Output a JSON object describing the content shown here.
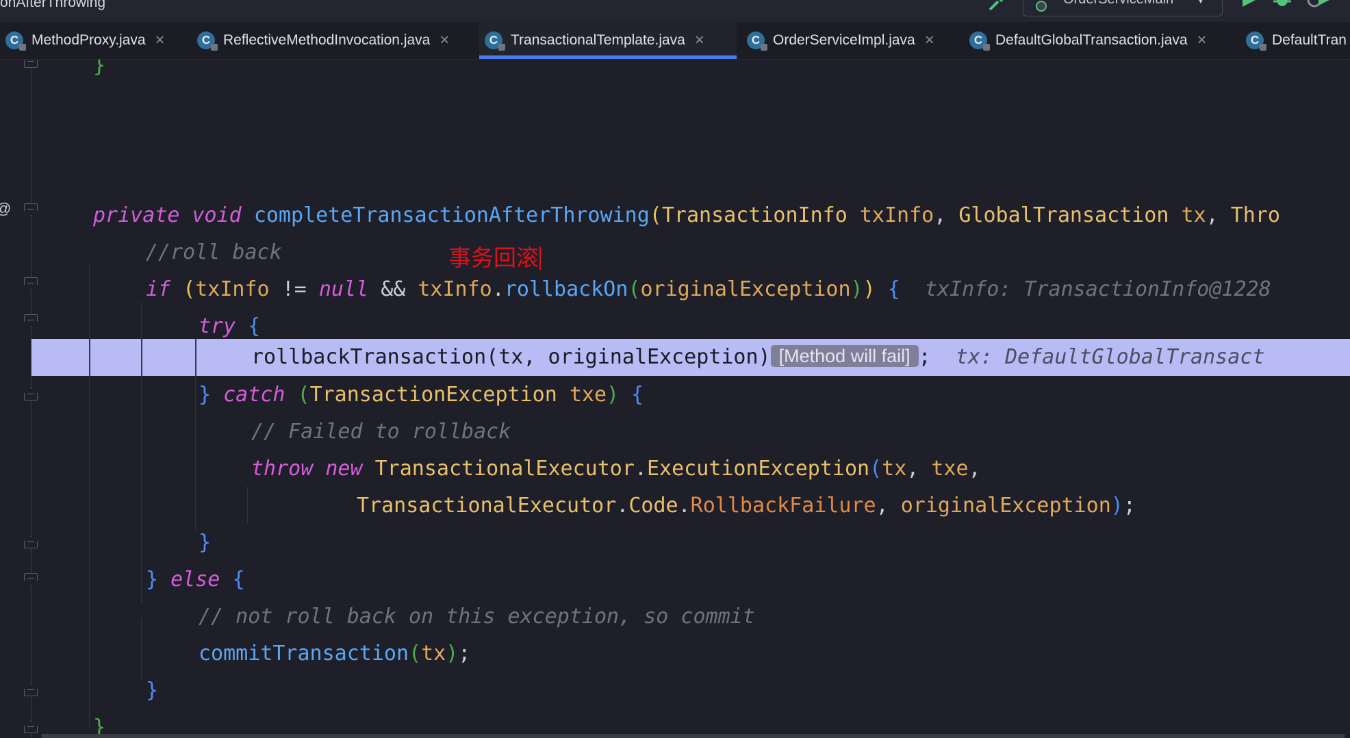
{
  "header": {
    "breadcrumb": "onAfterThrowing",
    "run_config": "OrderServiceMain"
  },
  "icons": {
    "hammer": "hammer-icon",
    "run": "play-icon",
    "debug": "bug-icon",
    "coverage": "coverage-icon",
    "chevron": "chevron-down-icon"
  },
  "colors": {
    "accent": "#4a7bf0",
    "keyword": "#d45dd9",
    "function": "#5aa7f5",
    "type": "#e8c06a",
    "comment": "#6e7281",
    "highlight": "#b9bbf5",
    "annotation_red": "#e0101a"
  },
  "tabs": [
    {
      "label": "MethodProxy.java",
      "close": "×"
    },
    {
      "label": "ReflectiveMethodInvocation.java",
      "close": "×"
    },
    {
      "label": "TransactionalTemplate.java",
      "close": "×"
    },
    {
      "label": "OrderServiceImpl.java",
      "close": "×"
    },
    {
      "label": "DefaultGlobalTransaction.java",
      "close": "×"
    },
    {
      "label": "DefaultTran",
      "close": ""
    }
  ],
  "tab_icon_letter": "C",
  "gutter": {
    "annotation": "@"
  },
  "code": {
    "l0": {
      "brace": "}"
    },
    "l1": {
      "kw1": "private",
      "kw2": "void",
      "fn": "completeTransactionAfterThrowing",
      "open": "(",
      "t1": "TransactionInfo",
      "p1": "txInfo",
      "comma1": ",",
      "t2": "GlobalTransaction",
      "p2": "tx",
      "comma2": ",",
      "t3": "Thro"
    },
    "l2": {
      "comment": "//roll back"
    },
    "l3": {
      "kw": "if",
      "open": "(",
      "v1": "txInfo",
      "op1": "!=",
      "kw2": "null",
      "op2": "&&",
      "v2": "txInfo",
      "dot": ".",
      "fn": "rollbackOn",
      "open2": "(",
      "arg": "originalException",
      "close2": ")",
      "close": ")",
      "brace": "{",
      "hint": "txInfo: TransactionInfo@1228"
    },
    "l4": {
      "kw": "try",
      "brace": "{"
    },
    "l5": {
      "call": "rollbackTransaction(tx, originalException)",
      "badge": "[Method will fail]",
      "semi": ";",
      "hint": "tx: DefaultGlobalTransact"
    },
    "l6": {
      "rb": "}",
      "kw": "catch",
      "open": "(",
      "t": "TransactionException",
      "p": "txe",
      "close": ")",
      "brace": "{"
    },
    "l7": {
      "comment": "// Failed to rollback"
    },
    "l8": {
      "kw1": "throw",
      "kw2": "new",
      "t1": "TransactionalExecutor",
      "dot": ".",
      "t2": "ExecutionException",
      "open": "(",
      "a1": "tx",
      "c1": ",",
      "a2": "txe",
      "c2": ","
    },
    "l9": {
      "t1": "TransactionalExecutor",
      "dot1": ".",
      "t2": "Code",
      "dot2": ".",
      "f": "RollbackFailure",
      "c": ",",
      "a": "originalException",
      "close": ")",
      "semi": ";"
    },
    "l10": {
      "brace": "}"
    },
    "l11": {
      "rb": "}",
      "kw": "else",
      "brace": "{"
    },
    "l12": {
      "comment": "// not roll back on this exception, so commit"
    },
    "l13": {
      "fn": "commitTransaction",
      "open": "(",
      "a": "tx",
      "close": ")",
      "semi": ";"
    },
    "l14": {
      "brace": "}"
    },
    "l15": {
      "brace": "}"
    }
  },
  "overlay_note": "事务回滚"
}
